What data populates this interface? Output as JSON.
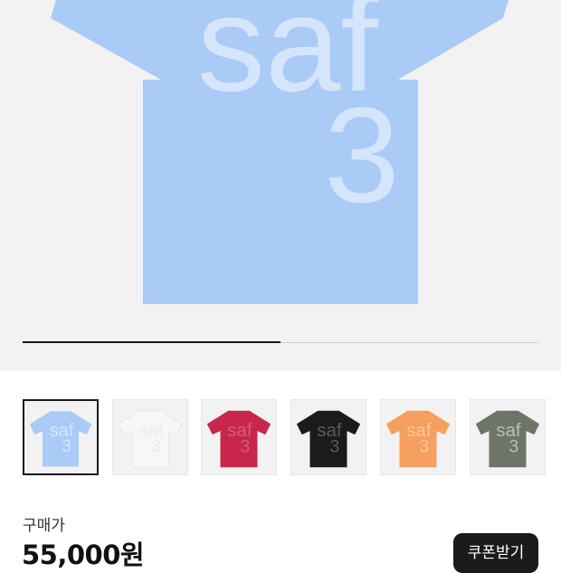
{
  "hero": {
    "shirt_color": "#a9cbf6",
    "print_line1": "saf",
    "print_line2": "3",
    "print_color": "#d5e5fb"
  },
  "gallery": {
    "progress": 0.5
  },
  "thumbnails": [
    {
      "color": "sky-blue",
      "fill": "#a9cbf6",
      "print": "#d5e5fb",
      "selected": true
    },
    {
      "color": "white",
      "fill": "#f7f7f7",
      "print": "#ececec",
      "selected": false
    },
    {
      "color": "red",
      "fill": "#c8264a",
      "print": "#d85c76",
      "selected": false
    },
    {
      "color": "black",
      "fill": "#1b1b1b",
      "print": "#5a5a5a",
      "selected": false
    },
    {
      "color": "orange",
      "fill": "#f5a05f",
      "print": "#f8c69c",
      "selected": false
    },
    {
      "color": "olive-gray",
      "fill": "#6f7468",
      "print": "#b9bcb5",
      "selected": false
    }
  ],
  "thumb_text": {
    "line1": "saf",
    "line2": "3"
  },
  "price": {
    "label": "구매가",
    "value": "55,000원"
  },
  "coupon_button": {
    "label": "쿠폰받기"
  }
}
